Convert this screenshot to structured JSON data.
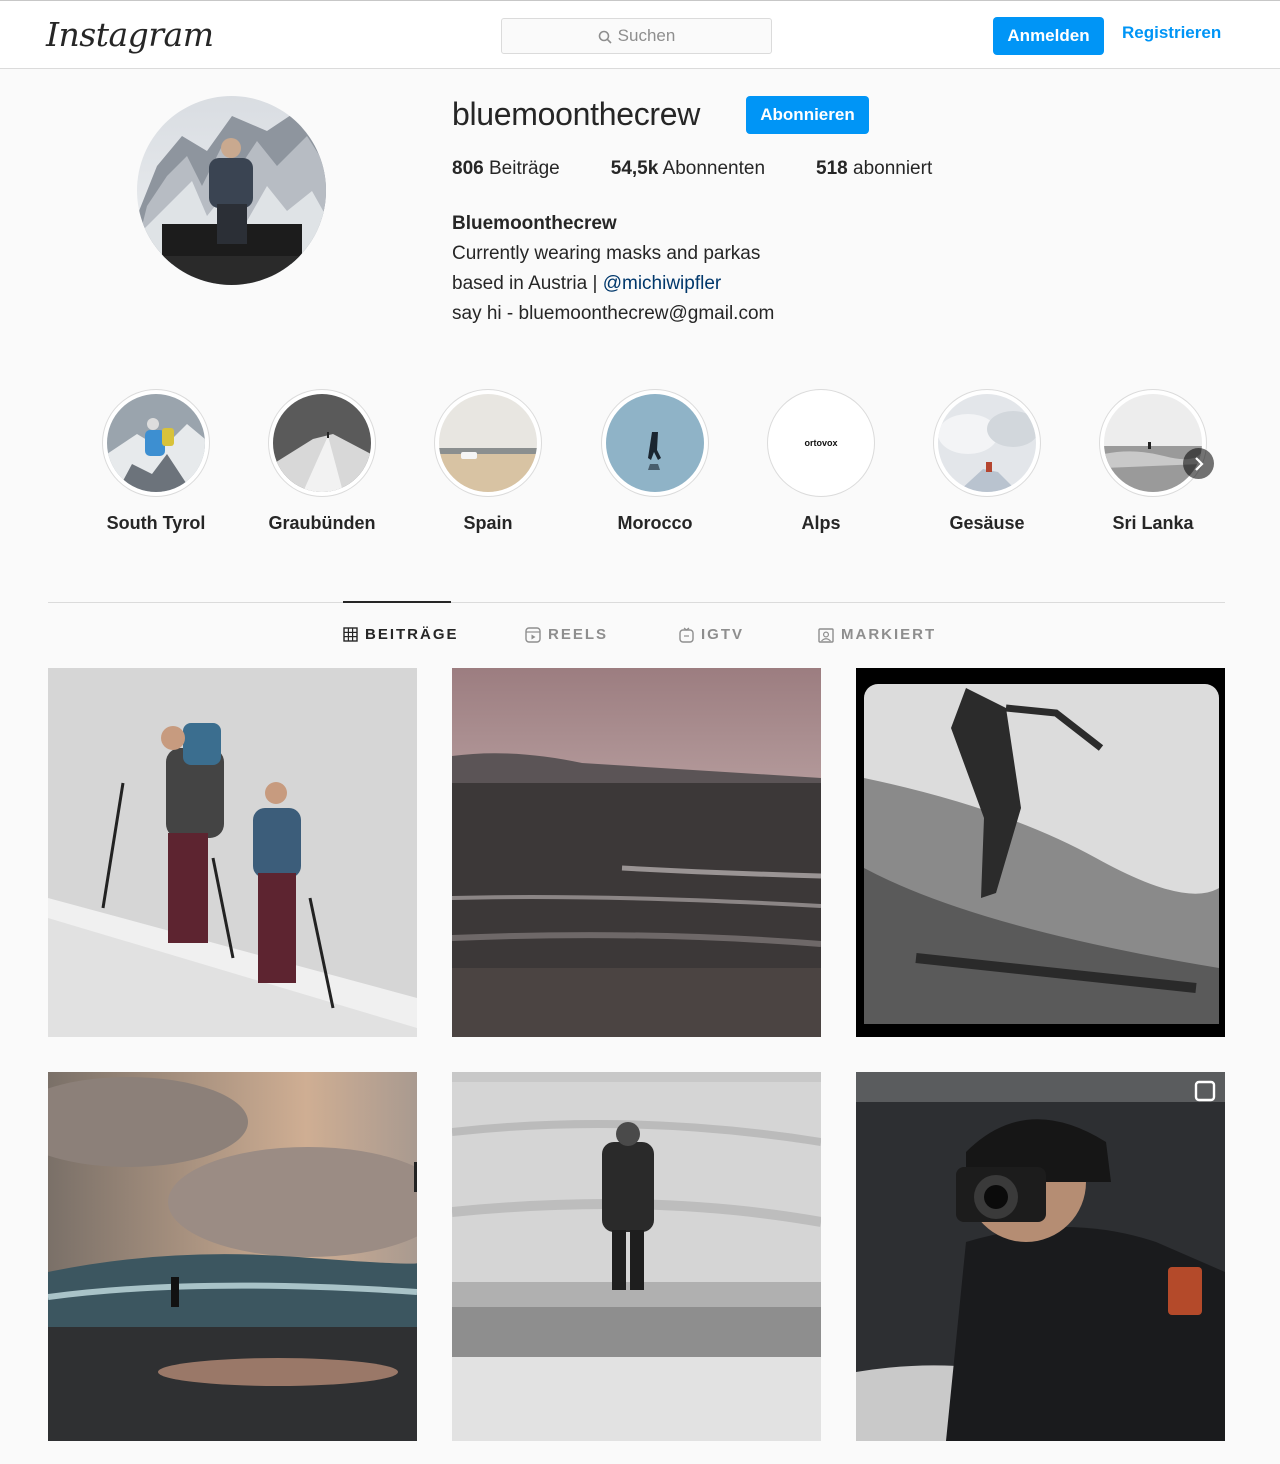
{
  "header": {
    "logo": "Instagram",
    "search_placeholder": "Suchen",
    "login_label": "Anmelden",
    "register_label": "Registrieren"
  },
  "profile": {
    "username": "bluemoonthecrew",
    "follow_label": "Abonnieren",
    "stats": {
      "posts_count": "806",
      "posts_label": " Beiträge",
      "followers_count": "54,5k",
      "followers_label": " Abonnenten",
      "following_count": "518",
      "following_label": " abonniert"
    },
    "bio": {
      "name": "Bluemoonthecrew",
      "line1": "Currently wearing masks and parkas",
      "line2_prefix": "based in Austria | ",
      "line2_mention": "@michiwipfler",
      "line3": "say hi - bluemoonthecrew@gmail.com"
    }
  },
  "highlights": [
    {
      "label": "South Tyrol"
    },
    {
      "label": "Graubünden"
    },
    {
      "label": "Spain"
    },
    {
      "label": "Morocco"
    },
    {
      "label": "Alps",
      "logo_text": "ortovox"
    },
    {
      "label": "Gesäuse"
    },
    {
      "label": "Sri Lanka"
    }
  ],
  "tabs": [
    {
      "label": "BEITRÄGE",
      "icon": "grid-icon",
      "active": true
    },
    {
      "label": "REELS",
      "icon": "reels-icon",
      "active": false
    },
    {
      "label": "IGTV",
      "icon": "igtv-icon",
      "active": false
    },
    {
      "label": "MARKIERT",
      "icon": "tagged-icon",
      "active": false
    }
  ],
  "colors": {
    "primary_blue": "#0095f6",
    "mention_blue": "#00376b",
    "text": "#262626",
    "muted": "#8e8e8e"
  }
}
